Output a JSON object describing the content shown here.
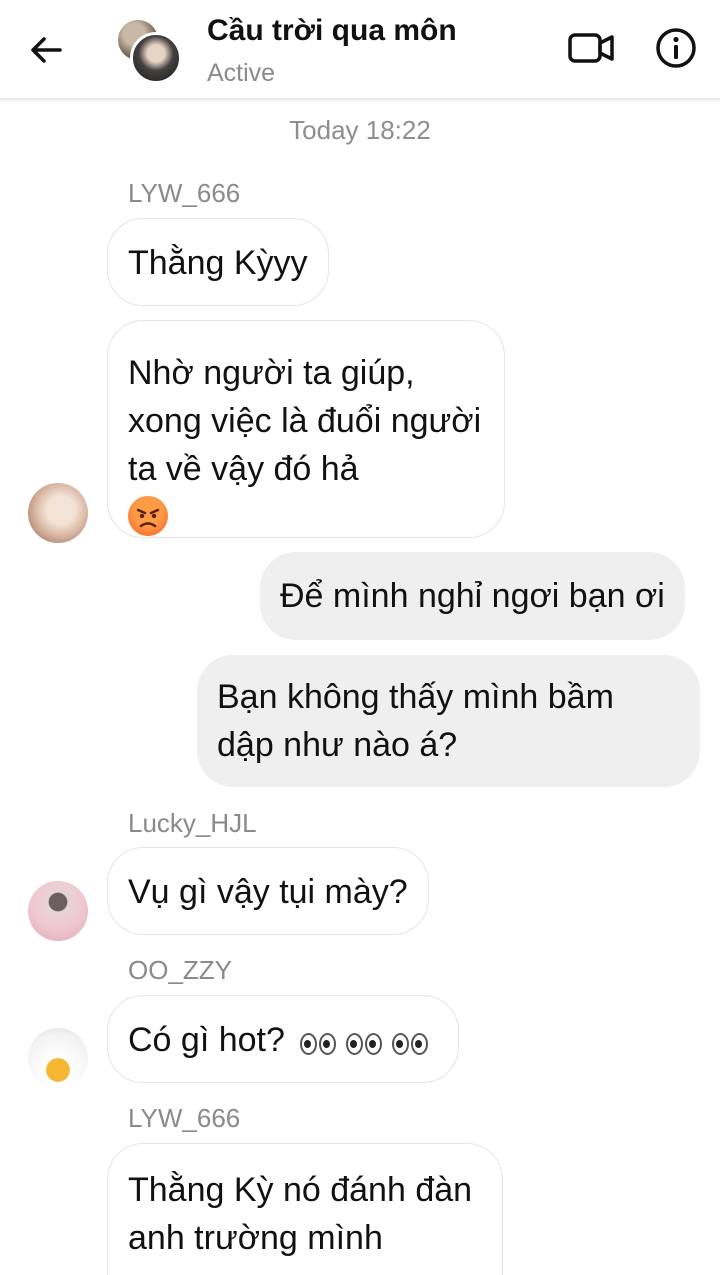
{
  "header": {
    "title": "Cầu trời qua môn",
    "status": "Active",
    "icons": [
      "back-arrow-icon",
      "video-call-icon",
      "info-icon"
    ]
  },
  "timestamp": "Today 18:22",
  "messages": [
    {
      "sender": "LYW_666",
      "text": "Thằng Kỳyy"
    },
    {
      "text": "Nhờ người ta giúp, xong việc là đuổi người ta về vậy đó hả",
      "emoji": "angry-face-emoji"
    },
    {
      "text": "Để mình nghỉ ngơi bạn ơi"
    },
    {
      "text": "Bạn không thấy mình bầm dập như nào á?"
    },
    {
      "sender": "Lucky_HJL",
      "text": "Vụ gì vậy tụi mày?"
    },
    {
      "sender": "OO_ZZY",
      "text": "Có gì hot?",
      "emoji": "eyes-emoji"
    },
    {
      "sender": "LYW_666",
      "text": "Thằng Kỳ nó đánh đàn anh trường mình"
    }
  ],
  "colors": {
    "incoming_bubble": "#ffffff",
    "outgoing_bubble": "#efefef",
    "secondary_text": "#8a8a8a"
  }
}
